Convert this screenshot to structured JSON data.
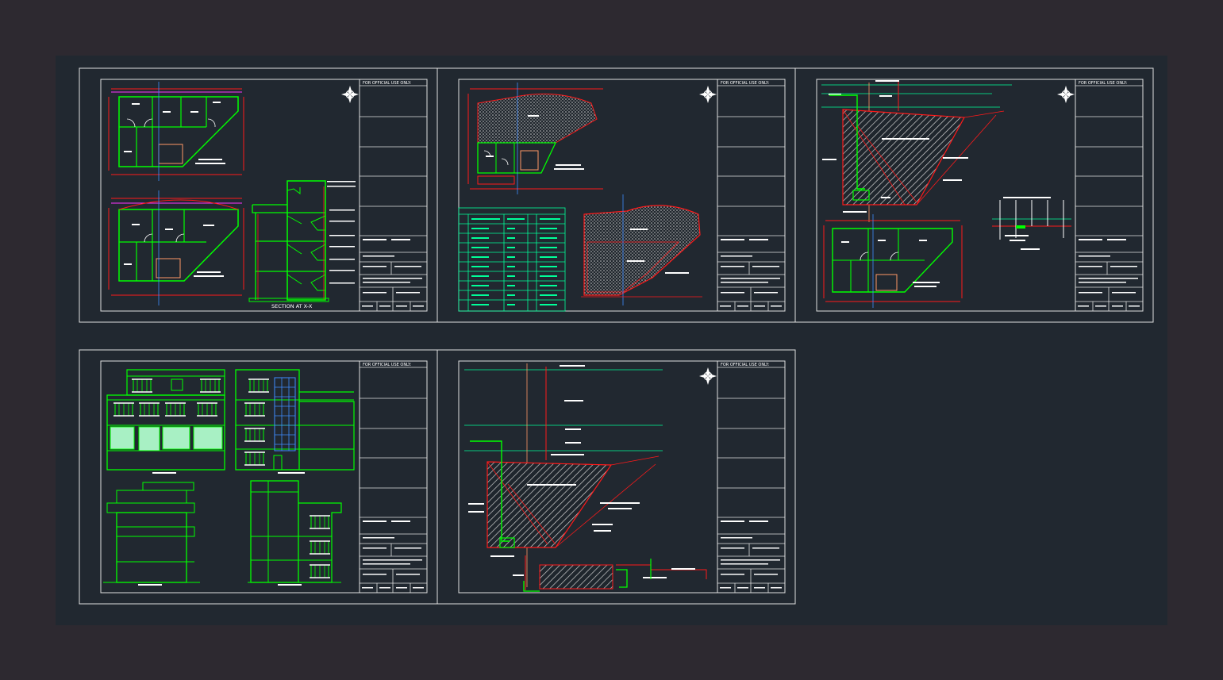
{
  "colors": {
    "background": "#2d2930",
    "canvas": "#212830",
    "frame": "#e0e0e0",
    "wall": "#00ff00",
    "dim": "#ff1a1a",
    "dim_alt": "#ff33ff",
    "text": "#ffffff",
    "accent_green": "#00ff99",
    "hatch": "#cccccc",
    "blue": "#3f8cff"
  },
  "title_block": {
    "header": "FOR OFFICIAL USE ONLY:"
  },
  "sheet1": {
    "section_label": "SECTION AT X-X"
  },
  "icons": {
    "north_arrow": "north-arrow-icon"
  }
}
